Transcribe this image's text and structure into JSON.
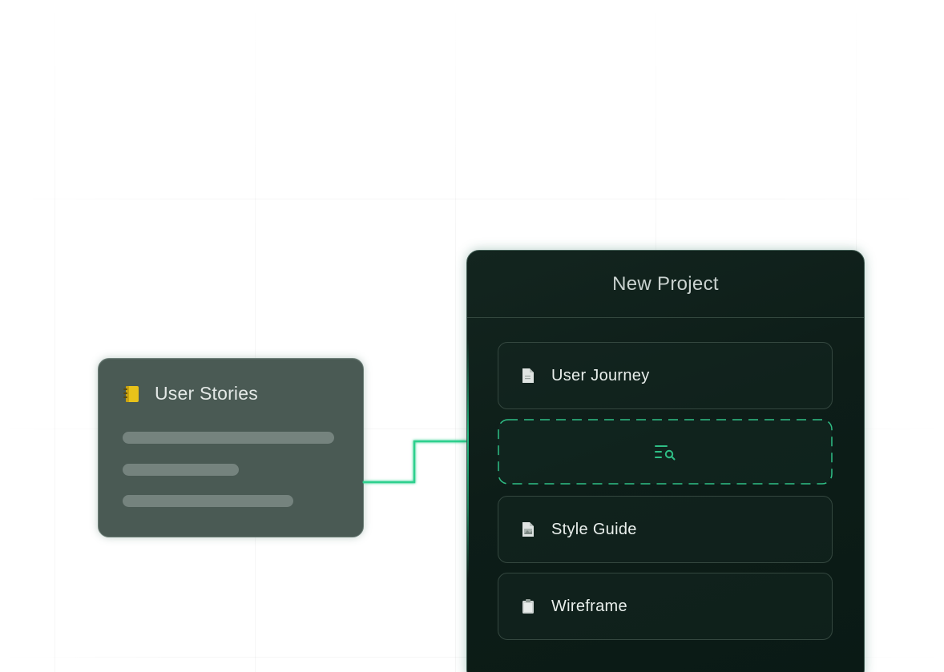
{
  "user_stories_card": {
    "title": "User Stories",
    "icon": "notebook-icon"
  },
  "project_panel": {
    "title": "New Project",
    "items": [
      {
        "label": "User Journey",
        "icon": "document-icon"
      },
      {
        "label": "Style Guide",
        "icon": "image-document-icon"
      },
      {
        "label": "Wireframe",
        "icon": "clipboard-icon"
      }
    ],
    "drop_zone": {
      "icon": "search-list-icon"
    }
  },
  "colors": {
    "accent": "#2fbf86",
    "panel_bg": "#0d1d18",
    "card_bg": "#4a5a54"
  }
}
